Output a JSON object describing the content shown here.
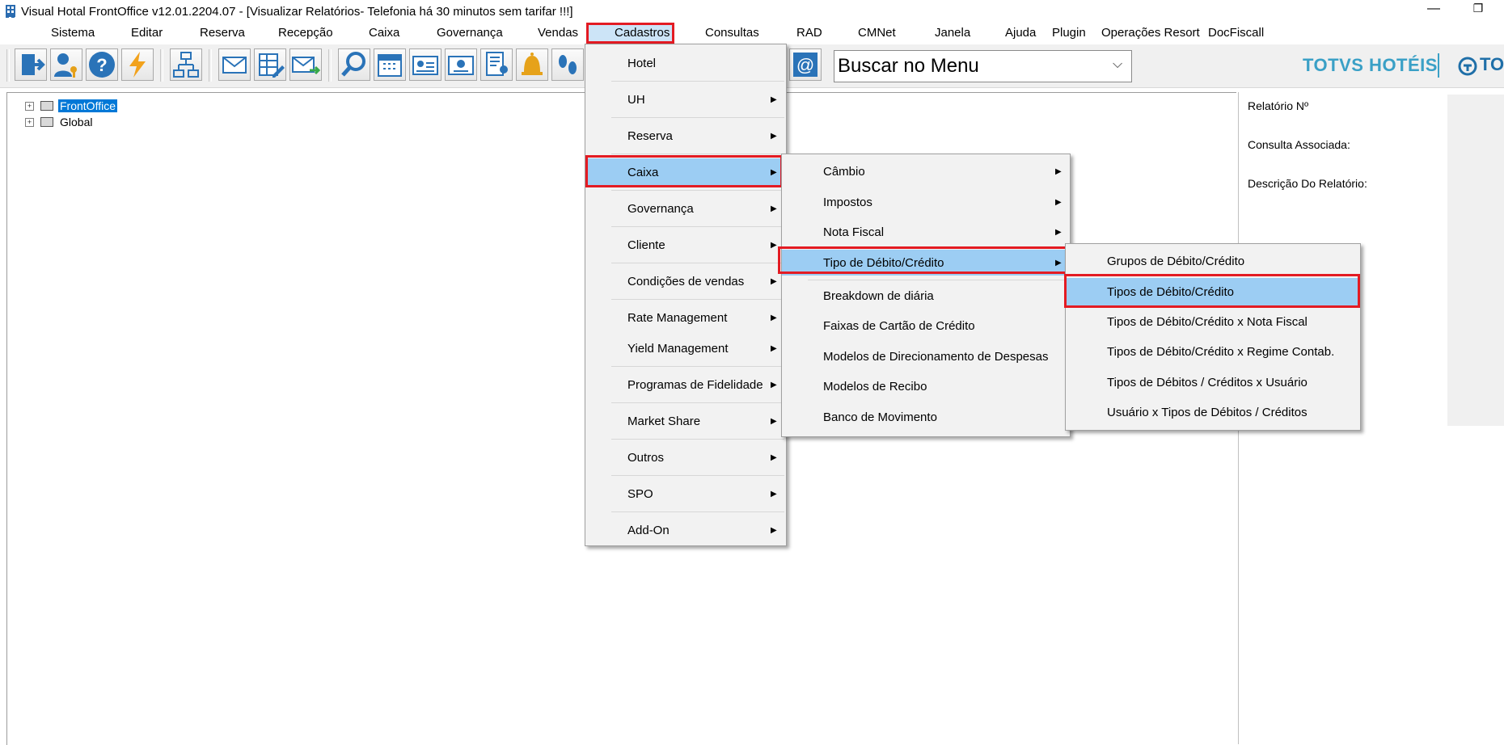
{
  "window": {
    "title": "Visual Hotal FrontOffice v12.01.2204.07 - [Visualizar Relatórios- Telefonia há 30 minutos sem tarifar !!!]",
    "minimize": "—",
    "restore": "❐"
  },
  "menubar": [
    "Sistema",
    "Editar",
    "Reserva",
    "Recepção",
    "Caixa",
    "Governança",
    "Vendas",
    "Cadastros",
    "Consultas",
    "RAD",
    "CMNet",
    "Janela",
    "Ajuda",
    "Plugin",
    "Operações Resort",
    "DocFiscall"
  ],
  "toolbar": {
    "search_text": "Buscar no Menu",
    "chevron": "⌵",
    "brand": "TOTVS HOTÉIS",
    "brand2": "TO",
    "icons": [
      "exit-icon",
      "user-key-icon",
      "help-icon",
      "lightning-icon",
      "org-chart-icon",
      "mail-icon",
      "grid-edit-icon",
      "mail-forward-icon",
      "search-icon",
      "calendar-icon",
      "id-card-icon",
      "badge-icon",
      "report-user-icon",
      "bell-icon",
      "footprint-icon",
      "email-at-icon"
    ]
  },
  "tree": {
    "items": [
      {
        "label": "FrontOffice",
        "selected": true,
        "exp": "+"
      },
      {
        "label": "Global",
        "selected": false,
        "exp": "+"
      }
    ]
  },
  "right_panel": {
    "relatorio": "Relatório Nº",
    "consulta": "Consulta Associada:",
    "descricao": "Descrição Do Relatório:"
  },
  "menu_cadastros": {
    "items": [
      "Hotel",
      "UH",
      "Reserva",
      "Caixa",
      "Governança",
      "Cliente",
      "Condições de vendas",
      "Rate Management",
      "Yield Management",
      "Programas de Fidelidade",
      "Market Share",
      "Outros",
      "SPO",
      "Add-On"
    ],
    "arrow": "▶"
  },
  "menu_caixa": {
    "items": [
      "Câmbio",
      "Impostos",
      "Nota Fiscal",
      "Tipo de Débito/Crédito",
      "Breakdown de diária",
      "Faixas de Cartão de Crédito",
      "Modelos de Direcionamento de Despesas",
      "Modelos de Recibo",
      "Banco de Movimento"
    ]
  },
  "menu_tipo": {
    "items": [
      "Grupos de Débito/Crédito",
      "Tipos de Débito/Crédito",
      "Tipos de Débito/Crédito x Nota Fiscal",
      "Tipos de Débito/Crédito x Regime Contab.",
      "Tipos de Débitos / Créditos x Usuário",
      "Usuário x Tipos de Débitos / Créditos"
    ]
  },
  "colors": {
    "highlight": "#9ccdf3",
    "annotation": "#e31b23",
    "brand": "#3aa0c6"
  }
}
